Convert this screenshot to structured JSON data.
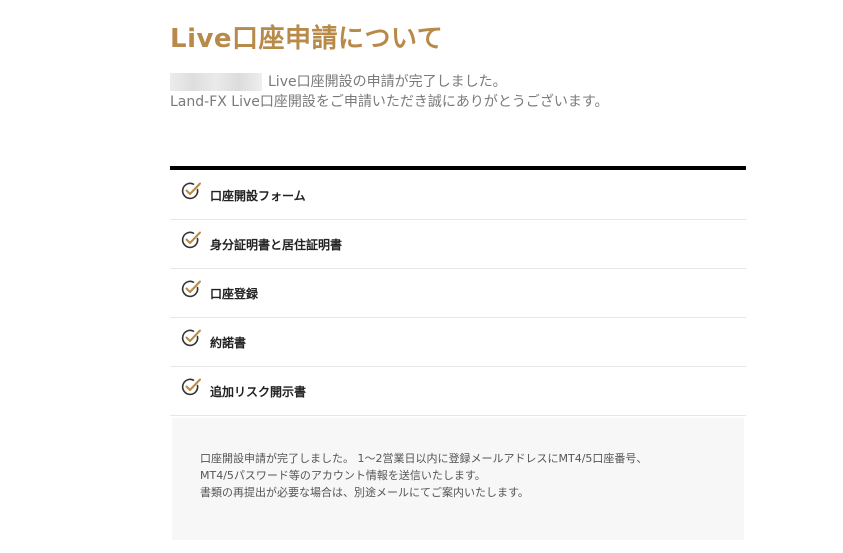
{
  "title": "Live口座申請について",
  "intro": {
    "line1": "Live口座開設の申請が完了しました。",
    "line2": "Land-FX Live口座開設をご申請いただき誠にありがとうございます。"
  },
  "steps": [
    {
      "label": "口座開設フォーム"
    },
    {
      "label": "身分証明書と居住証明書"
    },
    {
      "label": "口座登録"
    },
    {
      "label": "約諾書"
    },
    {
      "label": "追加リスク開示書"
    }
  ],
  "notice": {
    "line1": "口座開設申請が完了しました。 1～2営業日以内に登録メールアドレスにMT4/5口座番号、",
    "line2": "MT4/5パスワード等のアカウント情報を送信いたします。",
    "line3": "書類の再提出が必要な場合は、別途メールにてご案内いたします。"
  },
  "colors": {
    "accent": "#b88a4a",
    "check_stroke": "#333333"
  }
}
